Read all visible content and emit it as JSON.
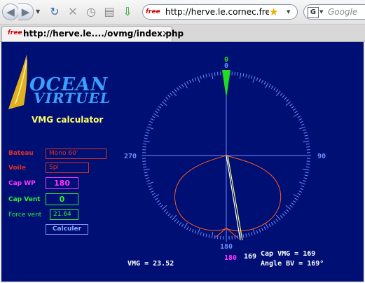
{
  "browser": {
    "back_icon": "back-arrow-icon",
    "forward_icon": "forward-arrow-icon",
    "reload_icon": "reload-icon",
    "stop_icon": "stop-icon",
    "history_icon": "history-icon",
    "bookmark_icon": "new-folder-icon",
    "download_icon": "download-icon",
    "favicon_text": "free",
    "url": "http://herve.le.cornec.free.f",
    "search_placeholder": "Google",
    "search_engine_letter": "G"
  },
  "tab": {
    "favicon_text": "free",
    "title": "http://herve.le..../ovmg/index.php",
    "close": "×"
  },
  "page": {
    "logo": {
      "line1": "OCEAN",
      "line2": "VIRTUEL"
    },
    "title": "VMG calculator",
    "form": {
      "bateau_label": "Bateau",
      "bateau_value": "Mono 60'",
      "voile_label": "Voile",
      "voile_value": "Spi",
      "capwp_label": "Cap WP",
      "capwp_value": "180",
      "capvent_label": "Cap Vent",
      "capvent_value": "0",
      "forcevent_label": "Force vent",
      "forcevent_value": "21.64",
      "button_label": "Calculer"
    },
    "dial": {
      "top_green": "0",
      "top_blue": "0",
      "left": "270",
      "right": "90",
      "bottom": "180",
      "wind_bearing": 0,
      "course_bearing": 169,
      "waypoint_bearing": 180
    },
    "results": {
      "vmg": "VMG = 23.52",
      "wp_heading": "180",
      "course_value": "169",
      "cap_vmg": "Cap VMG = 169",
      "angle_bv": "Angle BV = 169°"
    },
    "colors": {
      "background": "#000f73",
      "dial": "#6f8cff",
      "polar": "#ff5a1e",
      "wind_cone": "#22dd22",
      "yellow": "#ffff66",
      "magenta": "#ff33ff",
      "red": "#e03020"
    }
  }
}
